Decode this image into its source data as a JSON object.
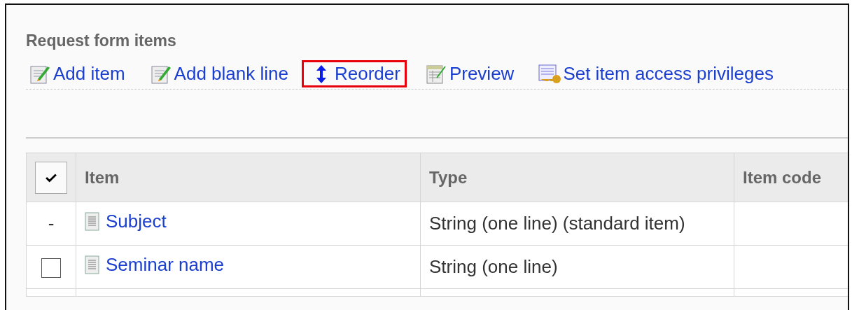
{
  "section_title": "Request form items",
  "toolbar": [
    {
      "label": "Add item",
      "kind": "edit",
      "highlighted": false
    },
    {
      "label": "Add blank line",
      "kind": "edit",
      "highlighted": false
    },
    {
      "label": "Reorder",
      "kind": "reorder",
      "highlighted": true
    },
    {
      "label": "Preview",
      "kind": "preview",
      "highlighted": false
    },
    {
      "label": "Set item access privileges",
      "kind": "privileges",
      "highlighted": false
    }
  ],
  "table": {
    "select_all": {
      "checked": true
    },
    "columns": [
      "Item",
      "Type",
      "Item code"
    ],
    "rows": [
      {
        "kind": "dash",
        "mark": "-",
        "item": "Subject",
        "type": "String (one line) (standard item)"
      },
      {
        "kind": "checkbox",
        "checked": false,
        "item": "Seminar name",
        "type": "String (one line)"
      }
    ]
  }
}
